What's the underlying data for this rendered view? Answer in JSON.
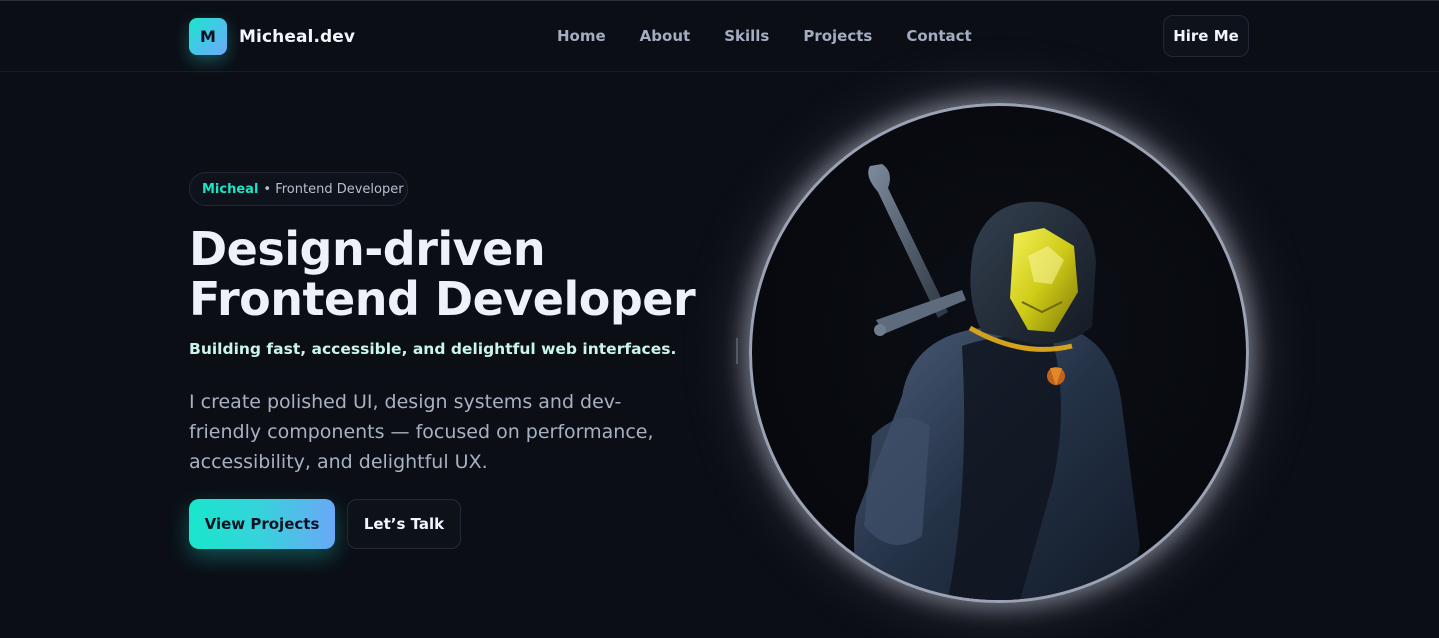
{
  "brand": {
    "badge": "M",
    "name": "Micheal.dev"
  },
  "nav": {
    "links": [
      "Home",
      "About",
      "Skills",
      "Projects",
      "Contact"
    ],
    "cta": "Hire Me"
  },
  "hero": {
    "pill_name": "Micheal",
    "pill_role": "• Frontend Developer",
    "title_line1": "Design-driven",
    "title_line2": "Frontend Developer",
    "tagline": "Building fast, accessible, and delightful web interfaces.",
    "description": "I create polished UI, design systems and dev-friendly components — focused on performance, accessibility, and delightful UX.",
    "primary_cta": "View Projects",
    "secondary_cta": "Let’s Talk"
  },
  "portrait": {
    "subject": "hooded-masked-figure-with-sword"
  },
  "colors": {
    "background": "#0b0e15",
    "accent": "#1fe3c6",
    "accent_blue": "#6aa8f7",
    "text_muted": "#a8b1c3"
  }
}
